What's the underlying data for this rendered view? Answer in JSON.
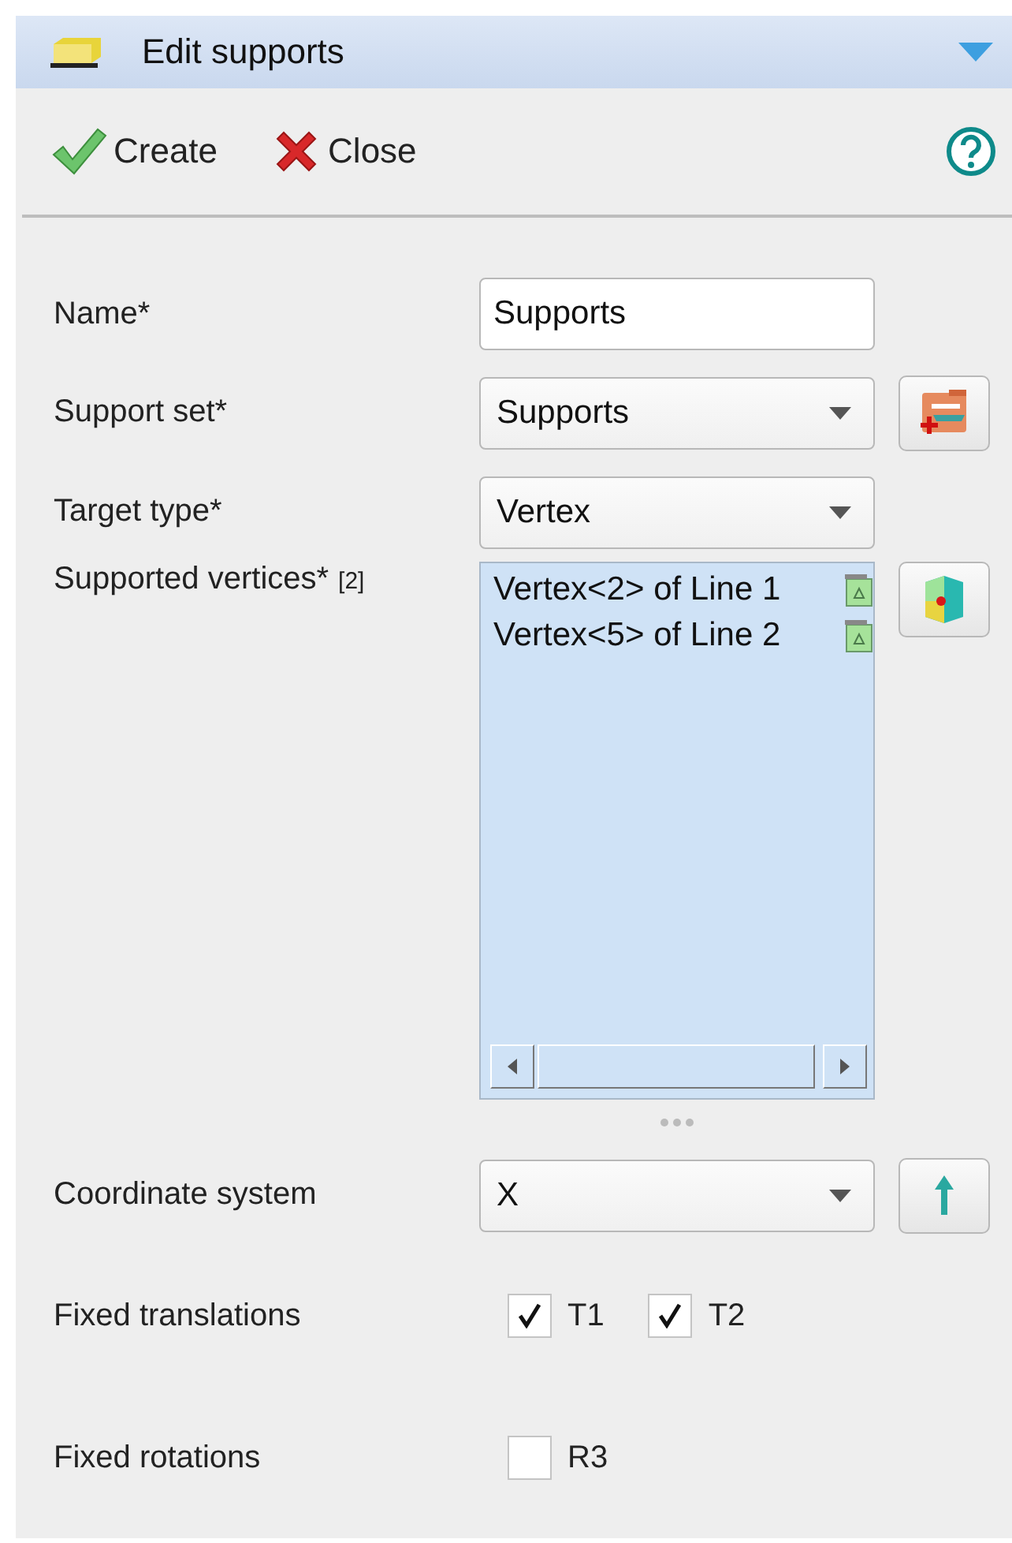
{
  "panel": {
    "title": "Edit supports",
    "expanded": true
  },
  "toolbar": {
    "buttons": [
      {
        "kind": "create",
        "label": "Create"
      },
      {
        "kind": "close",
        "label": "Close"
      }
    ]
  },
  "form": {
    "rows": [
      {
        "kind": "text",
        "label": "Name*",
        "value": "Supports"
      },
      {
        "kind": "select",
        "label": "Support set*",
        "value": "Supports",
        "tool_button": {
          "kind": "new-set"
        }
      },
      {
        "kind": "select",
        "label": "Target type*",
        "value": "Vertex"
      },
      {
        "kind": "list",
        "label": "Supported vertices*",
        "count": "[2]",
        "items": [
          "Vertex<2> of Line 1",
          "Vertex<5> of Line 2"
        ],
        "tool_button": {
          "kind": "pick"
        }
      },
      {
        "kind": "select",
        "label": "Coordinate system",
        "value": "X",
        "tool_button": {
          "kind": "axis"
        }
      },
      {
        "kind": "checks",
        "label": "Fixed translations",
        "checks": [
          {
            "label": "T1",
            "checked": true
          },
          {
            "label": "T2",
            "checked": true
          }
        ]
      },
      {
        "kind": "checks",
        "label": "Fixed rotations",
        "checks": [
          {
            "label": "R3",
            "checked": false
          }
        ]
      }
    ]
  }
}
